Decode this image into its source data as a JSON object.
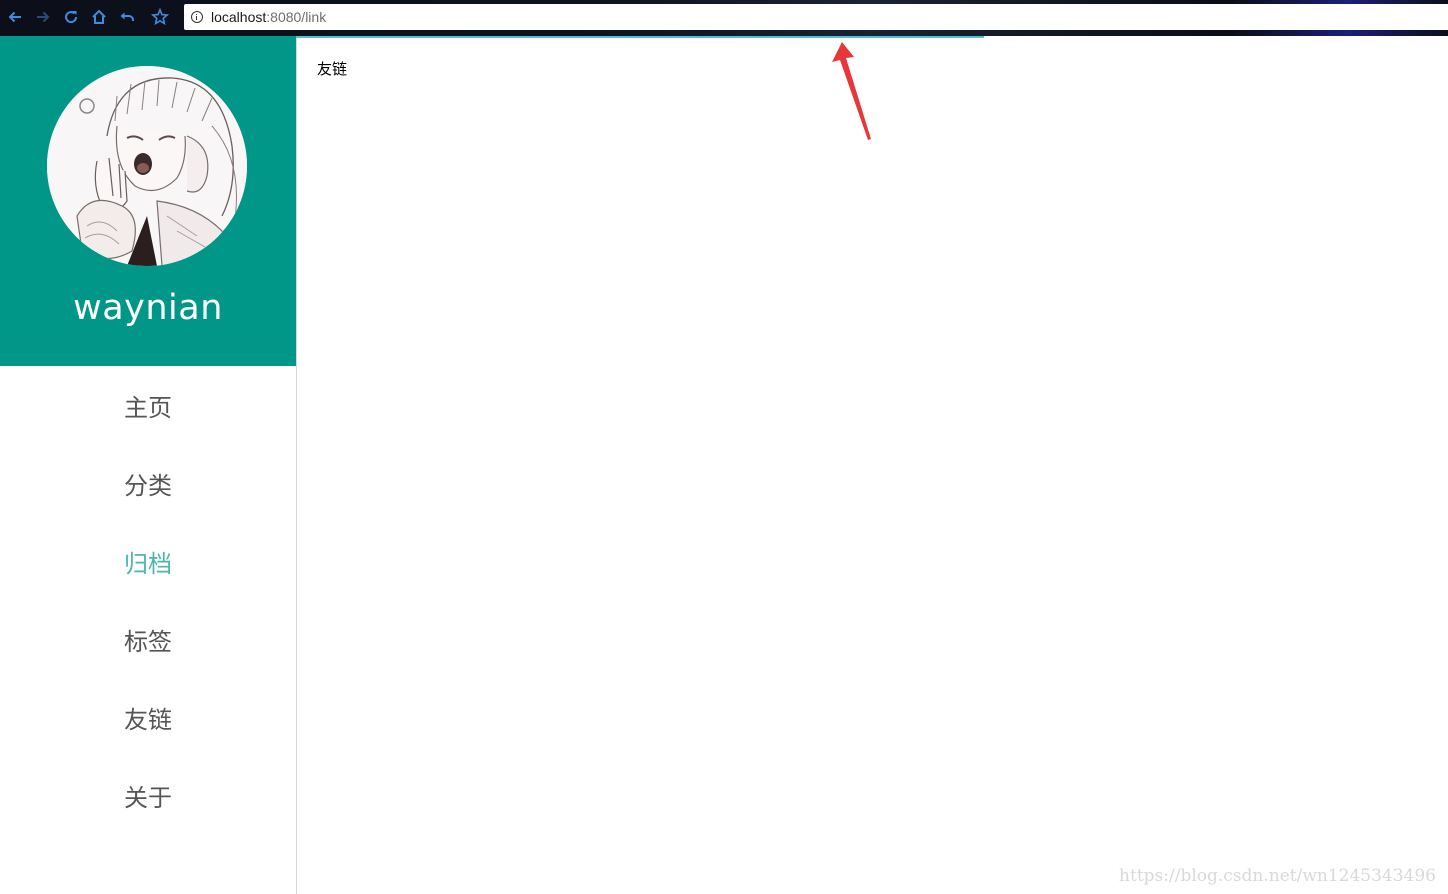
{
  "browser": {
    "url_host": "localhost",
    "url_path": ":8080/link"
  },
  "sidebar": {
    "username": "waynian",
    "menu": [
      {
        "label": "主页",
        "active": false
      },
      {
        "label": "分类",
        "active": false
      },
      {
        "label": "归档",
        "active": true
      },
      {
        "label": "标签",
        "active": false
      },
      {
        "label": "友链",
        "active": false
      },
      {
        "label": "关于",
        "active": false
      }
    ]
  },
  "content": {
    "title": "友链"
  },
  "watermark": "https://blog.csdn.net/wn1245343496",
  "colors": {
    "accent": "#009688",
    "active_item": "#4db6ac",
    "progress": "#4ec2c8",
    "annotation_arrow": "#e8373b"
  }
}
